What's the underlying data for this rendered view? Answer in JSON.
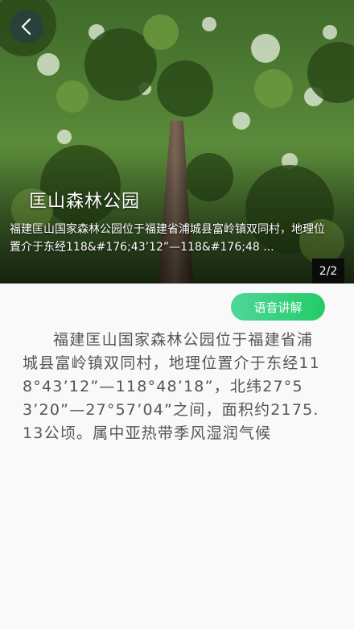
{
  "hero": {
    "title": "匡山森林公园",
    "description": "福建匡山国家森林公园位于福建省浦城县富岭镇双同村，地理位置介于东经118&#176;43’12”—118&#176;48 ...",
    "page_indicator": "2/2"
  },
  "icons": {
    "back": "chevron-left-icon"
  },
  "audio_button": {
    "label": "语音讲解",
    "color_start": "#4fd69a",
    "color_end": "#22cc66"
  },
  "article": {
    "body": "福建匡山国家森林公园位于福建省浦城县富岭镇双同村，地理位置介于东经118°43’12”—118°48’18”，北纬27°53’20”—27°57’04”之间，面积约2175.13公顷。属中亚热带季风湿润气候"
  }
}
